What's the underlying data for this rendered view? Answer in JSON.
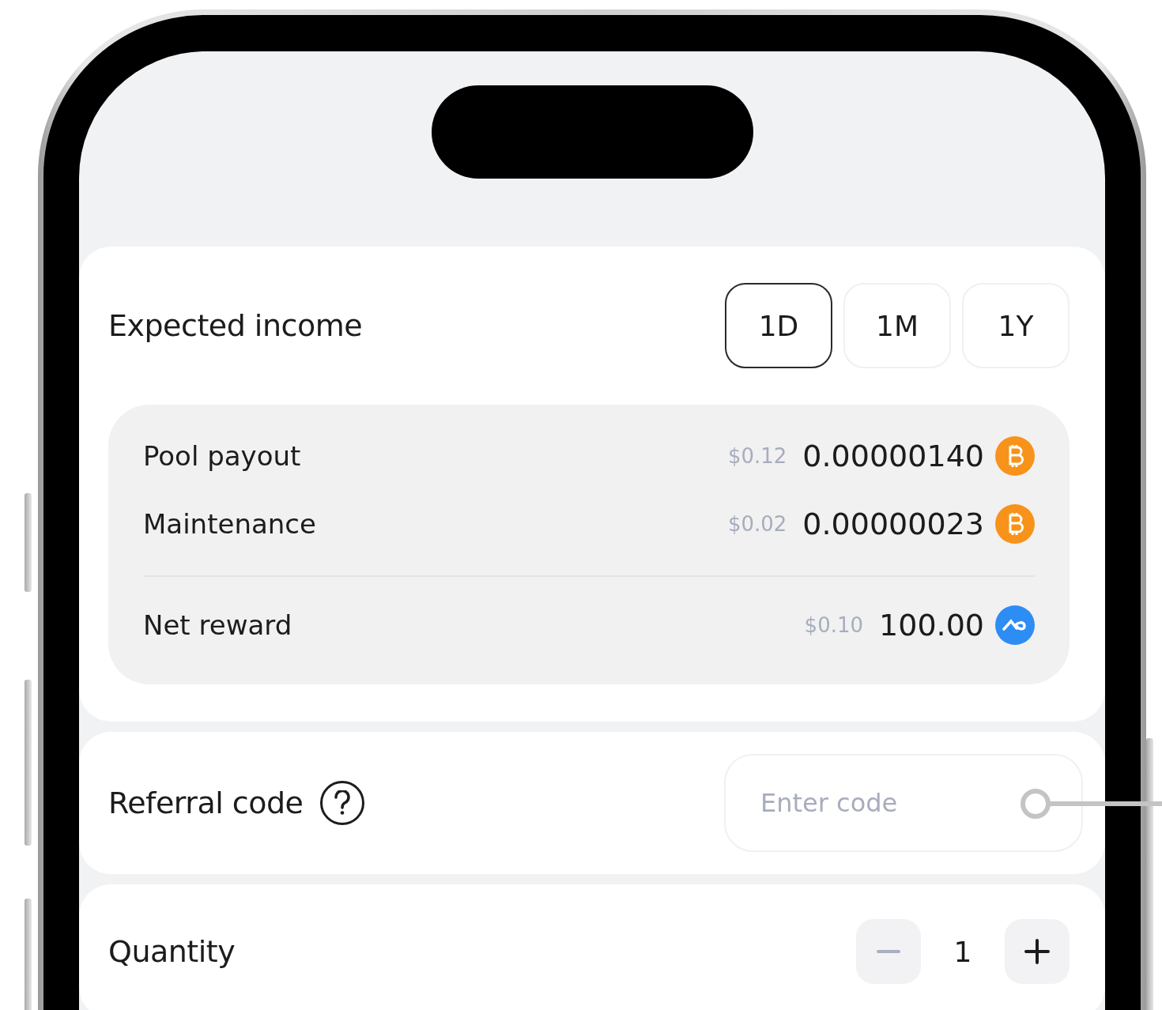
{
  "income": {
    "title": "Expected income",
    "periods": [
      {
        "label": "1D",
        "selected": true
      },
      {
        "label": "1M",
        "selected": false
      },
      {
        "label": "1Y",
        "selected": false
      }
    ],
    "rows": [
      {
        "label": "Pool payout",
        "fiat": "$0.12",
        "amount": "0.00000140",
        "kind": "bitcoin"
      },
      {
        "label": "Maintenance",
        "fiat": "$0.02",
        "amount": "0.00000023",
        "kind": "bitcoin"
      }
    ],
    "net": {
      "label": "Net reward",
      "fiat": "$0.10",
      "amount": "100.00",
      "kind": "token"
    }
  },
  "referral": {
    "label": "Referral code",
    "placeholder": "Enter code"
  },
  "quantity": {
    "label": "Quantity",
    "value": "1",
    "decrease_disabled": true
  }
}
